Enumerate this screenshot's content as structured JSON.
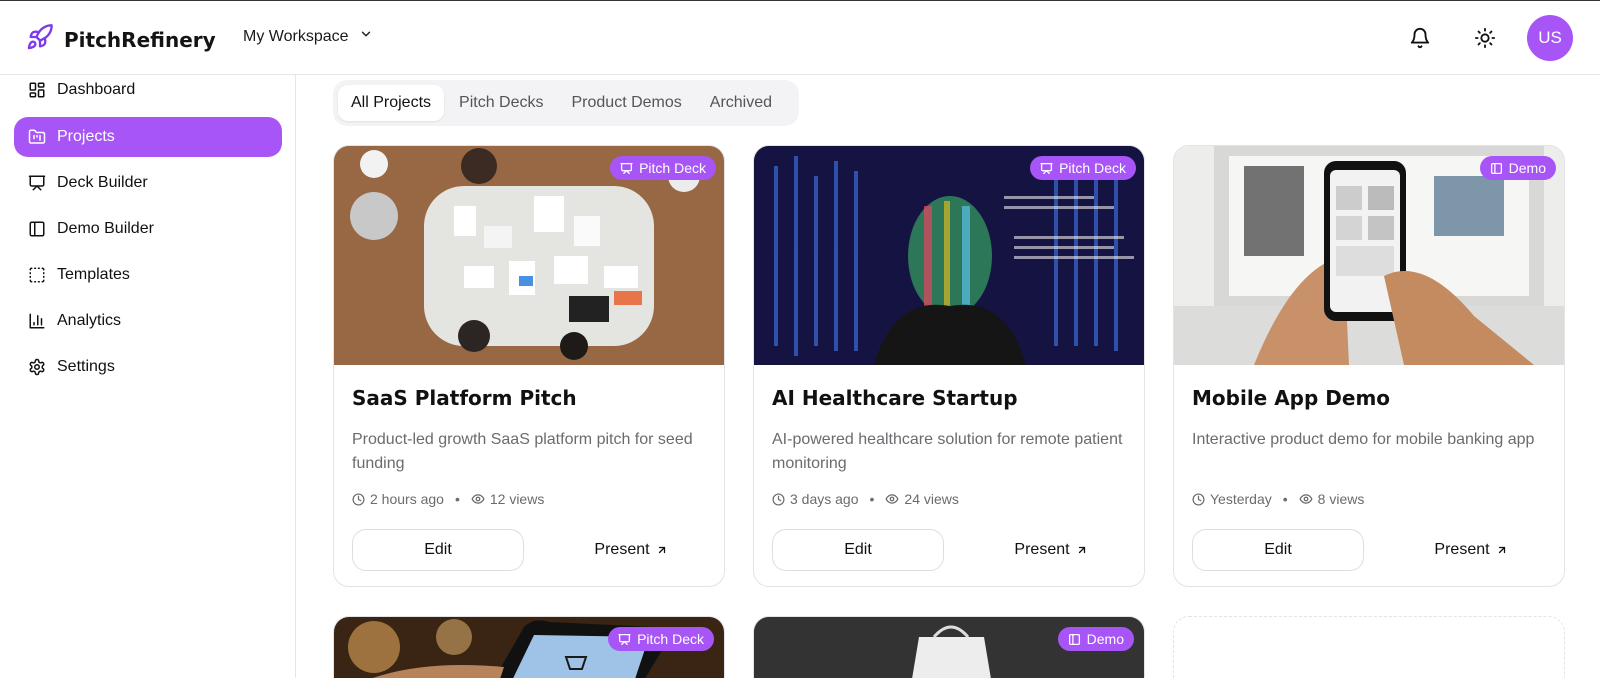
{
  "header": {
    "brand": "PitchRefinery",
    "workspace": "My Workspace",
    "avatar": "US"
  },
  "sidebar": {
    "items": [
      {
        "label": "Dashboard",
        "icon": "dashboard-icon"
      },
      {
        "label": "Projects",
        "icon": "projects-icon",
        "active": true
      },
      {
        "label": "Deck Builder",
        "icon": "presentation-icon"
      },
      {
        "label": "Demo Builder",
        "icon": "panel-icon"
      },
      {
        "label": "Templates",
        "icon": "templates-icon"
      },
      {
        "label": "Analytics",
        "icon": "analytics-icon"
      },
      {
        "label": "Settings",
        "icon": "gear-icon"
      }
    ]
  },
  "tabs": [
    {
      "label": "All Projects",
      "active": true
    },
    {
      "label": "Pitch Decks"
    },
    {
      "label": "Product Demos"
    },
    {
      "label": "Archived"
    }
  ],
  "cards": [
    {
      "badge": "Pitch Deck",
      "title": "SaaS Platform Pitch",
      "description": "Product-led growth SaaS platform pitch for seed funding",
      "time": "2 hours ago",
      "views": "12 views",
      "edit": "Edit",
      "present": "Present"
    },
    {
      "badge": "Pitch Deck",
      "title": "AI Healthcare Startup",
      "description": "AI-powered healthcare solution for remote patient monitoring",
      "time": "3 days ago",
      "views": "24 views",
      "edit": "Edit",
      "present": "Present"
    },
    {
      "badge": "Demo",
      "title": "Mobile App Demo",
      "description": "Interactive product demo for mobile banking app",
      "time": "Yesterday",
      "views": "8 views",
      "edit": "Edit",
      "present": "Present"
    }
  ],
  "partial_cards": [
    {
      "badge": "Pitch Deck"
    },
    {
      "badge": "Demo"
    }
  ],
  "colors": {
    "accent": "#a855f7",
    "brand_icon": "#7c3aed"
  }
}
